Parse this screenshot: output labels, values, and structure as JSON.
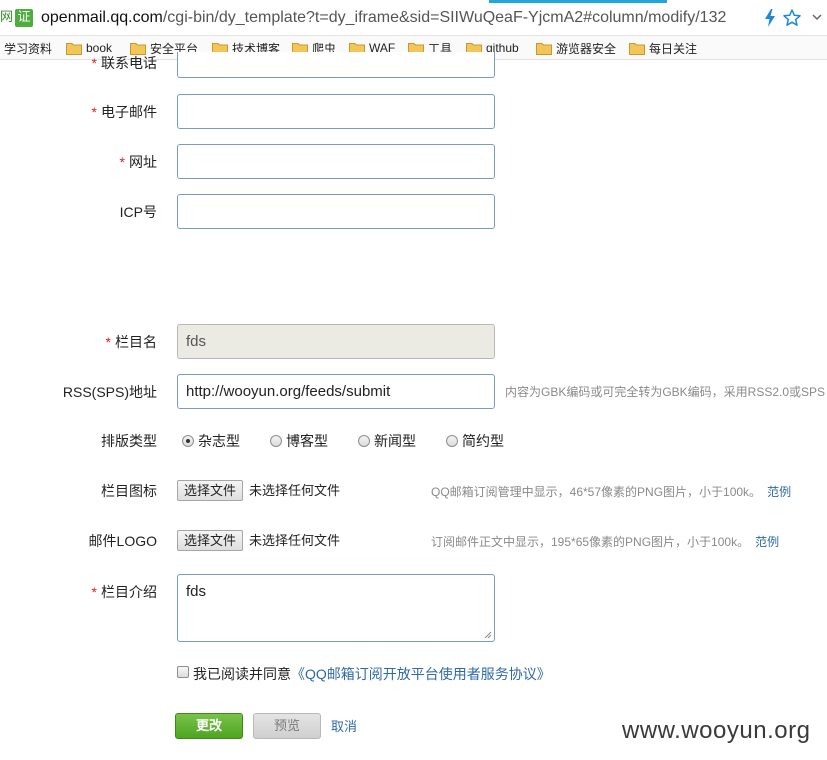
{
  "browser": {
    "security_tag_1": "网",
    "security_tag_2": "证",
    "url_host": "openmail.qq.com",
    "url_path": "/cgi-bin/dy_template?t=dy_iframe&sid=SIIWuQeaF-YjcmA2#column/modify/132",
    "icons": [
      "lightning-icon",
      "star-icon",
      "more-icon"
    ]
  },
  "bookmarks": [
    {
      "label": "学习资料",
      "folder": false
    },
    {
      "label": "book",
      "folder": true
    },
    {
      "label": "安全平台",
      "folder": true
    },
    {
      "label": "技术博客",
      "folder": true
    },
    {
      "label": "爬虫",
      "folder": true
    },
    {
      "label": "WAF",
      "folder": true
    },
    {
      "label": "工具",
      "folder": true
    },
    {
      "label": "github",
      "folder": true
    },
    {
      "label": "游览器安全",
      "folder": true
    },
    {
      "label": "每日关注",
      "folder": true
    }
  ],
  "form": {
    "required_mark": "*",
    "phone": {
      "label": "联系电话",
      "value": ""
    },
    "email": {
      "label": "电子邮件",
      "value": ""
    },
    "website": {
      "label": "网址",
      "value": ""
    },
    "icp": {
      "label": "ICP号",
      "value": ""
    },
    "column_name": {
      "label": "栏目名",
      "value": "fds"
    },
    "rss": {
      "label": "RSS(SPS)地址",
      "value": "http://wooyun.org/feeds/submit",
      "hint": "内容为GBK编码或可完全转为GBK编码，采用RSS2.0或SPS"
    },
    "layout": {
      "label": "排版类型",
      "options": [
        "杂志型",
        "博客型",
        "新闻型",
        "简约型"
      ],
      "selected": "杂志型"
    },
    "column_icon": {
      "label": "栏目图标",
      "button": "选择文件",
      "status": "未选择任何文件",
      "hint": "QQ邮箱订阅管理中显示，46*57像素的PNG图片，小于100k。",
      "example": "范例"
    },
    "mail_logo": {
      "label": "邮件LOGO",
      "button": "选择文件",
      "status": "未选择任何文件",
      "hint": "订阅邮件正文中显示，195*65像素的PNG图片，小于100k。",
      "example": "范例"
    },
    "intro": {
      "label": "栏目介绍",
      "value": "fds"
    },
    "agreement": {
      "checked": false,
      "text": "我已阅读并同意",
      "protocol": "《QQ邮箱订阅开放平台使用者服务协议》"
    },
    "actions": {
      "submit": "更改",
      "preview": "预览",
      "cancel": "取消"
    }
  },
  "watermark": "www.wooyun.org",
  "colors": {
    "accent_green": "#4ea422",
    "link_blue": "#2f6aa8",
    "required_red": "#e02020",
    "input_border": "#7a9cc4"
  }
}
